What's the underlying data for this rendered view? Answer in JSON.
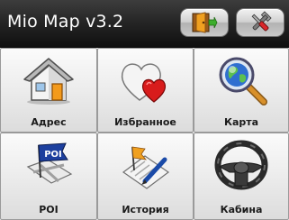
{
  "header": {
    "title": "Mio Map v3.2",
    "buttons": [
      {
        "name": "exit",
        "icon": "door-exit-icon"
      },
      {
        "name": "settings",
        "icon": "tools-icon"
      }
    ]
  },
  "menu": {
    "items": [
      {
        "label": "Адрес",
        "icon": "house-icon"
      },
      {
        "label": "Избранное",
        "icon": "hearts-icon"
      },
      {
        "label": "Карта",
        "icon": "globe-magnifier-icon"
      },
      {
        "label": "POI",
        "icon": "poi-flag-icon"
      },
      {
        "label": "История",
        "icon": "checklist-pen-icon"
      },
      {
        "label": "Кабина",
        "icon": "steering-wheel-icon"
      }
    ]
  },
  "colors": {
    "titlebar": "#1c1c1c",
    "tile": "#e6e6e6",
    "accent_orange": "#f09a1a",
    "accent_red": "#d42020"
  }
}
